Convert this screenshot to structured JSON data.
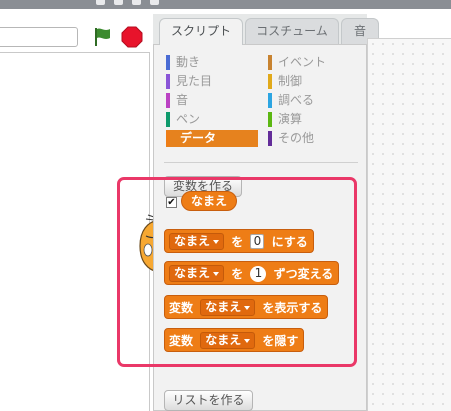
{
  "palette": {
    "tabs": [
      {
        "label": "スクリプト"
      },
      {
        "label": "コスチューム"
      },
      {
        "label": "音"
      }
    ],
    "categories": [
      {
        "label": "動き",
        "color": "#4a6cd4"
      },
      {
        "label": "イベント",
        "color": "#c88330"
      },
      {
        "label": "見た目",
        "color": "#8a55d7"
      },
      {
        "label": "制御",
        "color": "#e1a91a"
      },
      {
        "label": "音",
        "color": "#bb42c3"
      },
      {
        "label": "調べる",
        "color": "#2ca5e2"
      },
      {
        "label": "ペン",
        "color": "#0e9a6c"
      },
      {
        "label": "演算",
        "color": "#5cb712"
      },
      {
        "label": "データ",
        "color": "#ee7d16"
      },
      {
        "label": "その他",
        "color": "#632d99"
      }
    ],
    "selected_category": "データ",
    "make_variable_label": "変数を作る",
    "make_list_label": "リストを作る",
    "variable": {
      "name": "なまえ",
      "checked": true
    },
    "blocks": {
      "set": {
        "var": "なまえ",
        "to": "を",
        "value": "0",
        "suffix": "にする"
      },
      "change": {
        "var": "なまえ",
        "by": "を",
        "value": "1",
        "suffix": "ずつ変える"
      },
      "show": {
        "prefix": "変数",
        "var": "なまえ",
        "suffix": "を表示する"
      },
      "hide": {
        "prefix": "変数",
        "var": "なまえ",
        "suffix": "を隠す"
      }
    }
  },
  "colors": {
    "highlight": "#ea3868",
    "data_block": "#ee7d16",
    "stop": "#e8132b",
    "flag": "#3c8b2f"
  }
}
